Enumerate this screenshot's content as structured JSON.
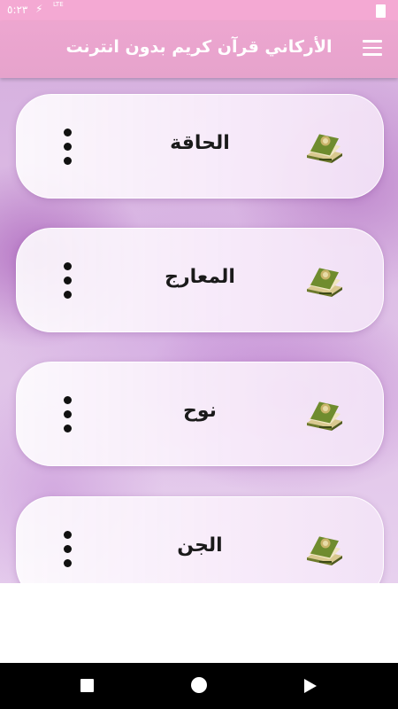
{
  "status_bar": {
    "time": "٥:٢٣",
    "network": "LTE"
  },
  "app_bar": {
    "title": "الأركاني قرآن كريم بدون انترنت",
    "menu_icon": "hamburger-menu-icon"
  },
  "surahs": [
    {
      "name": "الحاقة"
    },
    {
      "name": "المعارج"
    },
    {
      "name": "نوح"
    },
    {
      "name": "الجن"
    }
  ],
  "colors": {
    "appbar": "#eda6d0",
    "statusbar": "#f4a9d3",
    "background": "#d7b2e0",
    "navbar": "#000000"
  },
  "nav_bar": {
    "recents_icon": "square-icon",
    "home_icon": "circle-icon",
    "back_icon": "triangle-back-icon"
  }
}
